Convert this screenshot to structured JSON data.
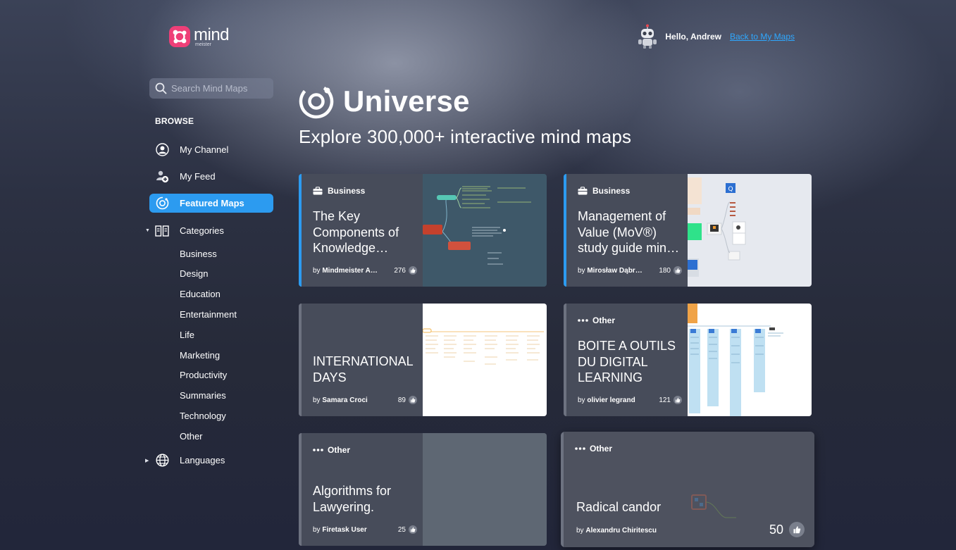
{
  "brand": {
    "word": "mind",
    "sub": "meister"
  },
  "header": {
    "greeting": "Hello, Andrew",
    "back_link": "Back to My Maps"
  },
  "search": {
    "placeholder": "Search Mind Maps"
  },
  "sidebar": {
    "browse_label": "BROWSE",
    "items": [
      {
        "label": "My Channel",
        "icon": "user-icon"
      },
      {
        "label": "My Feed",
        "icon": "feed-icon"
      },
      {
        "label": "Featured Maps",
        "icon": "universe-icon",
        "active": true
      },
      {
        "label": "Categories",
        "icon": "book-icon",
        "expanded": true
      },
      {
        "label": "Languages",
        "icon": "globe-icon",
        "expanded": false
      }
    ],
    "categories": [
      "Business",
      "Design",
      "Education",
      "Entertainment",
      "Life",
      "Marketing",
      "Productivity",
      "Summaries",
      "Technology",
      "Other"
    ]
  },
  "hero": {
    "title": "Universe",
    "subtitle": "Explore 300,000+ interactive mind maps"
  },
  "colors": {
    "accent": "#2c9bf0",
    "brand": "#ee3f78",
    "link": "#2ea8ff"
  },
  "cards": [
    {
      "category": "Business",
      "category_icon": "briefcase-icon",
      "title": "The Key Components of Knowledge…",
      "author": "Mindmeister A…",
      "likes": "276"
    },
    {
      "category": "Business",
      "category_icon": "briefcase-icon",
      "title": "Management of Value (MoV®) study guide min…",
      "author": "Mirosław Dąbr…",
      "likes": "180"
    },
    {
      "category": "",
      "category_icon": "",
      "title": "INTERNATIONAL DAYS",
      "author": "Samara Croci",
      "likes": "89"
    },
    {
      "category": "Other",
      "category_icon": "dots-icon",
      "title": "BOITE A OUTILS DU DIGITAL LEARNING",
      "author": "olivier legrand",
      "likes": "121"
    },
    {
      "category": "Other",
      "category_icon": "dots-icon",
      "title": "Algorithms for Lawyering.",
      "author": "Firetask User",
      "likes": "25"
    },
    {
      "category": "Other",
      "category_icon": "dots-icon",
      "title": "Radical candor",
      "author": "Alexandru Chiritescu",
      "likes": "50"
    }
  ],
  "by_prefix": "by"
}
